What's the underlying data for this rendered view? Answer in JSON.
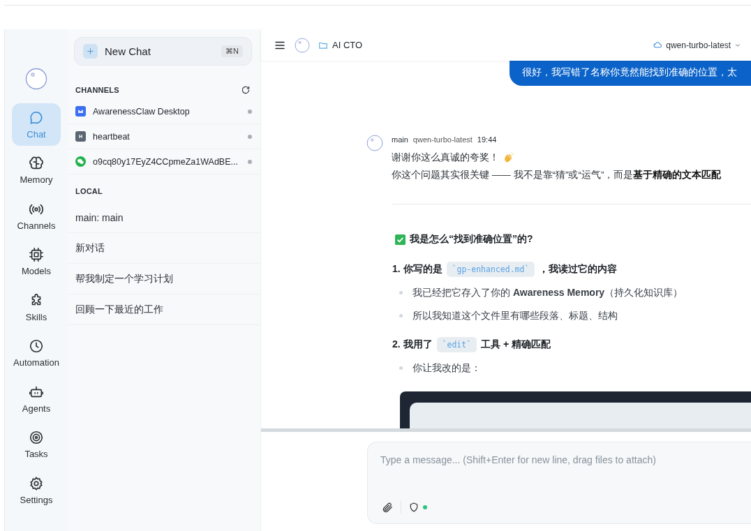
{
  "nav": {
    "items": [
      {
        "label": "Chat",
        "selected": true
      },
      {
        "label": "Memory",
        "selected": false
      },
      {
        "label": "Channels",
        "selected": false
      },
      {
        "label": "Models",
        "selected": false
      },
      {
        "label": "Skills",
        "selected": false
      },
      {
        "label": "Automation",
        "selected": false
      },
      {
        "label": "Agents",
        "selected": false
      },
      {
        "label": "Tasks",
        "selected": false
      },
      {
        "label": "Settings",
        "selected": false
      }
    ]
  },
  "sidebar": {
    "new_chat": {
      "label": "New Chat",
      "shortcut": "⌘N"
    },
    "channels_title": "CHANNELS",
    "channels": [
      {
        "name": "AwarenessClaw Desktop",
        "kind": "app"
      },
      {
        "name": "heartbeat",
        "kind": "letter",
        "badge": "H"
      },
      {
        "name": "o9cq80y17EyZ4CCpmeZa1WAdBE...",
        "kind": "wechat"
      }
    ],
    "local_title": "LOCAL",
    "local": [
      {
        "label": "main: main"
      },
      {
        "label": "新对话"
      },
      {
        "label": "帮我制定一个学习计划"
      },
      {
        "label": "回顾一下最近的工作"
      }
    ]
  },
  "header": {
    "title": "AI CTO",
    "model": "qwen-turbo-latest"
  },
  "conversation": {
    "user_message": "很好，我写错了名称你竟然能找到准确的位置，太",
    "reply": {
      "agent": "main",
      "model": "qwen-turbo-latest",
      "time": "19:44",
      "lines": [
        "谢谢你这么真诚的夸奖！",
        "你这个问题其实很关键 —— 我不是靠“猜”或“运气”，而是**基于精确的文本匹配**"
      ],
      "blocks": [
        {
          "kind": "heading",
          "text": "我是怎么“找到准确位置”的?"
        },
        {
          "kind": "numbered",
          "parts": [
            {
              "text": "1. 你写的是"
            },
            {
              "code": "`gp-enhanced.md`"
            },
            {
              "text": "，我读过它的内容"
            }
          ]
        },
        {
          "kind": "bullet",
          "text": "我已经把它存入了你的 **Awareness Memory**（持久化知识库）"
        },
        {
          "kind": "bullet",
          "text": "所以我知道这个文件里有哪些段落、标题、结构"
        },
        {
          "kind": "numbered",
          "parts": [
            {
              "text": "2. 我用了"
            },
            {
              "code": "`edit`"
            },
            {
              "text": "工具 + 精确匹配"
            }
          ]
        },
        {
          "kind": "bullet",
          "text": "你让我改的是："
        },
        {
          "kind": "code"
        }
      ]
    }
  },
  "composer": {
    "placeholder": "Type a message... (Shift+Enter for new line, drag files to attach)"
  }
}
